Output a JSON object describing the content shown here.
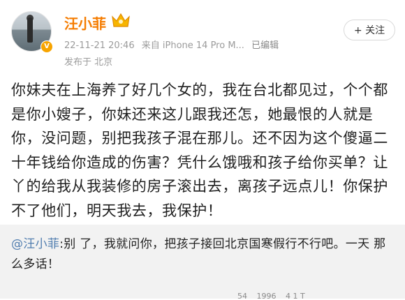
{
  "user": {
    "name": "汪小菲",
    "verified_badge": "V",
    "avatar_icon": "avatar-photo"
  },
  "post_meta": {
    "datetime": "22-11-21 20:46",
    "source": "来自 iPhone 14 Pro M...",
    "edited": "已编辑",
    "location": "发布于 北京"
  },
  "follow_button": {
    "label": "+ 关注"
  },
  "post": {
    "text": "你妹夫在上海养了好几个女的，我在台北都见过，个个都是你小嫂子，你妹还来这儿跟我还怎，她最恨的人就是你，没问题，别把我孩子混在那儿。还不因为这个傻逼二十年钱给你造成的伤害？凭什么饿哦和孩子给你买单？让丫的给我从我装修的房子滚出去，离孩子远点儿！你保护不了他们，明天我去，我保护！"
  },
  "repost": {
    "mention": "@汪小菲",
    "text": ":别     了，我就问你，把孩子接回北京国寒假行不行吧。一天      那么多话！"
  },
  "stats": {
    "reposts": "54",
    "comments": "1996",
    "likes": "4 1 T"
  },
  "colors": {
    "username": "#f57c00",
    "mention": "#507daf",
    "repost_bg": "#f2f2f2"
  }
}
